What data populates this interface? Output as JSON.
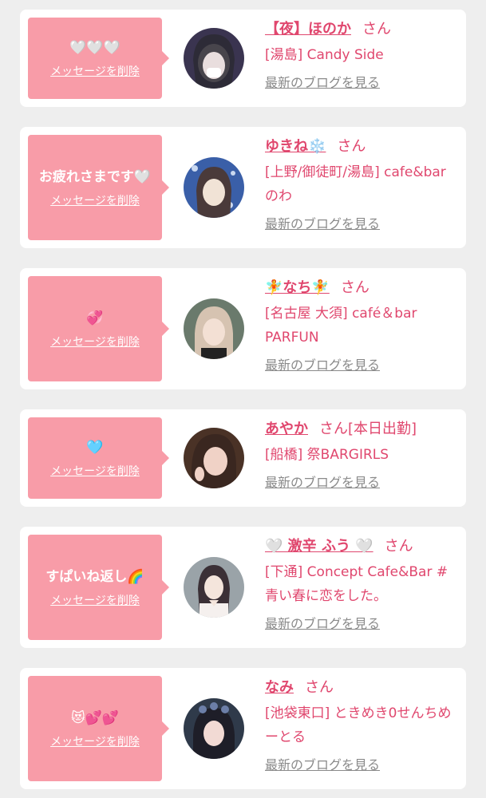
{
  "delete_label": "メッセージを削除",
  "blog_label": "最新のブログを見る",
  "san_label": "さん",
  "items": [
    {
      "message": "🤍🤍🤍",
      "name": "【夜】ほのか",
      "suffix": "",
      "shop": "[湯島] Candy Side",
      "avatar_colors": [
        "#3a3450",
        "#e9dede",
        "#2c2a33"
      ]
    },
    {
      "message": "お疲れさまです🤍",
      "name": "ゆきね❄️",
      "suffix": "",
      "shop": "[上野/御徒町/湯島] cafe&bar のわ",
      "avatar_colors": [
        "#3a5fa8",
        "#f1e3d6",
        "#c9d8f0"
      ]
    },
    {
      "message": "💞",
      "name": "🧚なち🧚",
      "suffix": "",
      "shop": "[名古屋 大須] café＆bar PARFUN",
      "avatar_colors": [
        "#6a7a6c",
        "#f3e0d4",
        "#d6c3b1"
      ]
    },
    {
      "message": "🩵",
      "name": "あやか",
      "suffix": "[本日出勤]",
      "shop": "[船橋] 祭BARGIRLS",
      "avatar_colors": [
        "#4a3226",
        "#f0d2c6",
        "#3a2720"
      ]
    },
    {
      "message": "すぱいね返し🌈",
      "name": "🤍 激辛 ふう 🤍",
      "suffix": "",
      "shop": "[下通] Concept Cafe&Bar #青い春に恋をした。",
      "avatar_colors": [
        "#9aa3a8",
        "#f4e5dc",
        "#3b3036"
      ]
    },
    {
      "message": "😻💕💕",
      "name": "なみ",
      "suffix": "",
      "shop": "[池袋東口] ときめき0せんちめーとる",
      "avatar_colors": [
        "#2f3a4a",
        "#f2dad4",
        "#6c7fa8"
      ]
    }
  ]
}
